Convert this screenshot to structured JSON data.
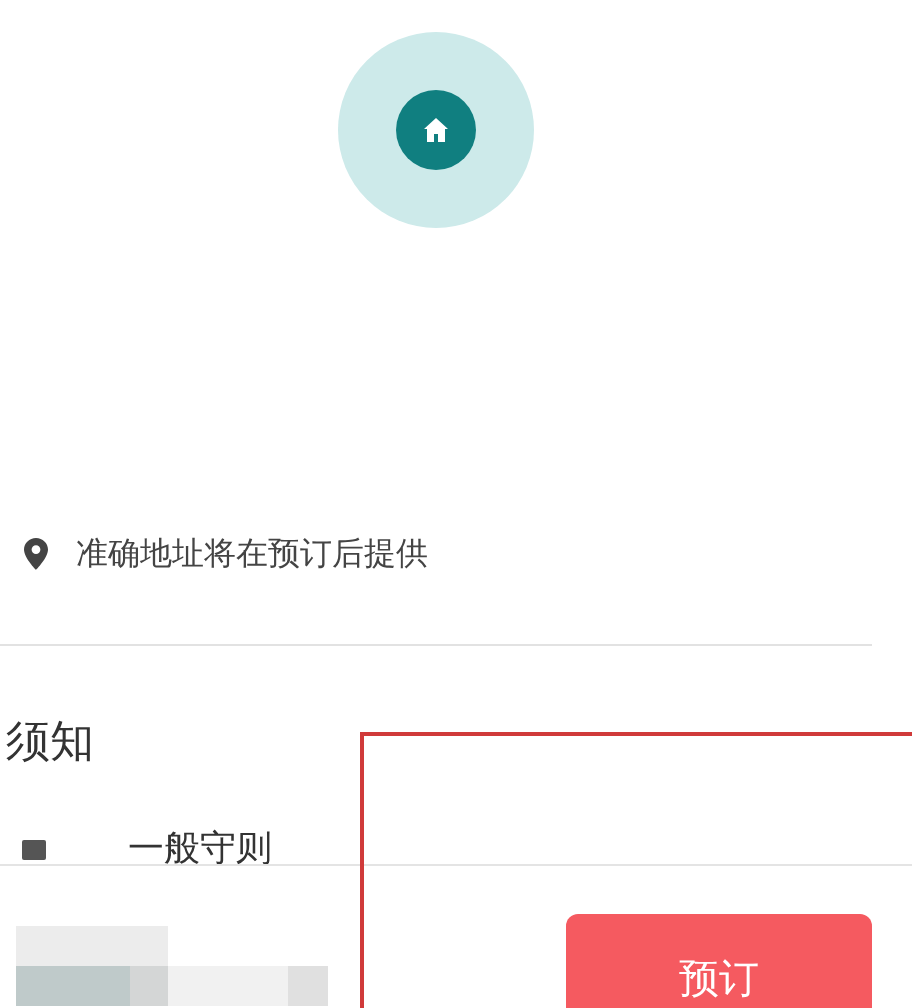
{
  "location_note": {
    "text": "准确地址将在预订后提供"
  },
  "section": {
    "title": "须知"
  },
  "rules": [
    {
      "text": "一般守则"
    }
  ],
  "bottom_bar": {
    "book_button": "预订"
  }
}
